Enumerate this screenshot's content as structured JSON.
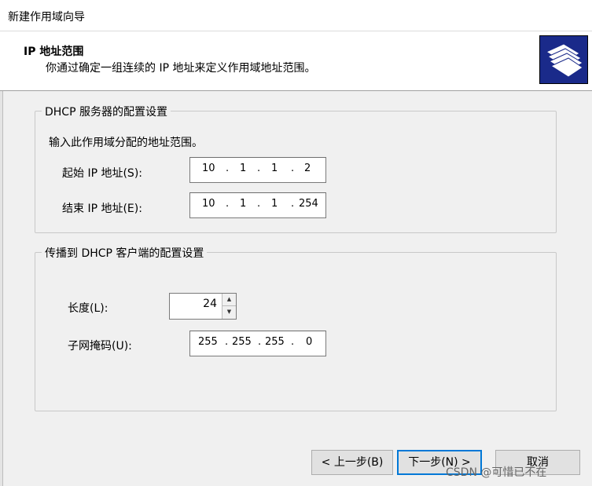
{
  "window": {
    "title": "新建作用域向导"
  },
  "header": {
    "title": "IP 地址范围",
    "subtitle": "你通过确定一组连续的 IP 地址来定义作用域地址范围。"
  },
  "server_group": {
    "legend": "DHCP 服务器的配置设置",
    "instruction": "输入此作用域分配的地址范围。",
    "start_label": "起始 IP 地址(S):",
    "start_ip": [
      "10",
      "1",
      "1",
      "2"
    ],
    "end_label": "结束 IP 地址(E):",
    "end_ip": [
      "10",
      "1",
      "1",
      "254"
    ]
  },
  "client_group": {
    "legend": "传播到 DHCP 客户端的配置设置",
    "length_label": "长度(L):",
    "length_value": "24",
    "mask_label": "子网掩码(U):",
    "mask": [
      "255",
      "255",
      "255",
      "0"
    ]
  },
  "buttons": {
    "back": "< 上一步(B)",
    "next": "下一步(N) >",
    "cancel": "取消"
  },
  "watermark": "CSDN @可惜已不在",
  "colors": {
    "header_icon_bg": "#1a2a8a",
    "default_button_border": "#0078d7"
  },
  "icons": {
    "header": "folders-icon",
    "spin_up": "arrow-up-icon",
    "spin_down": "arrow-down-icon"
  }
}
